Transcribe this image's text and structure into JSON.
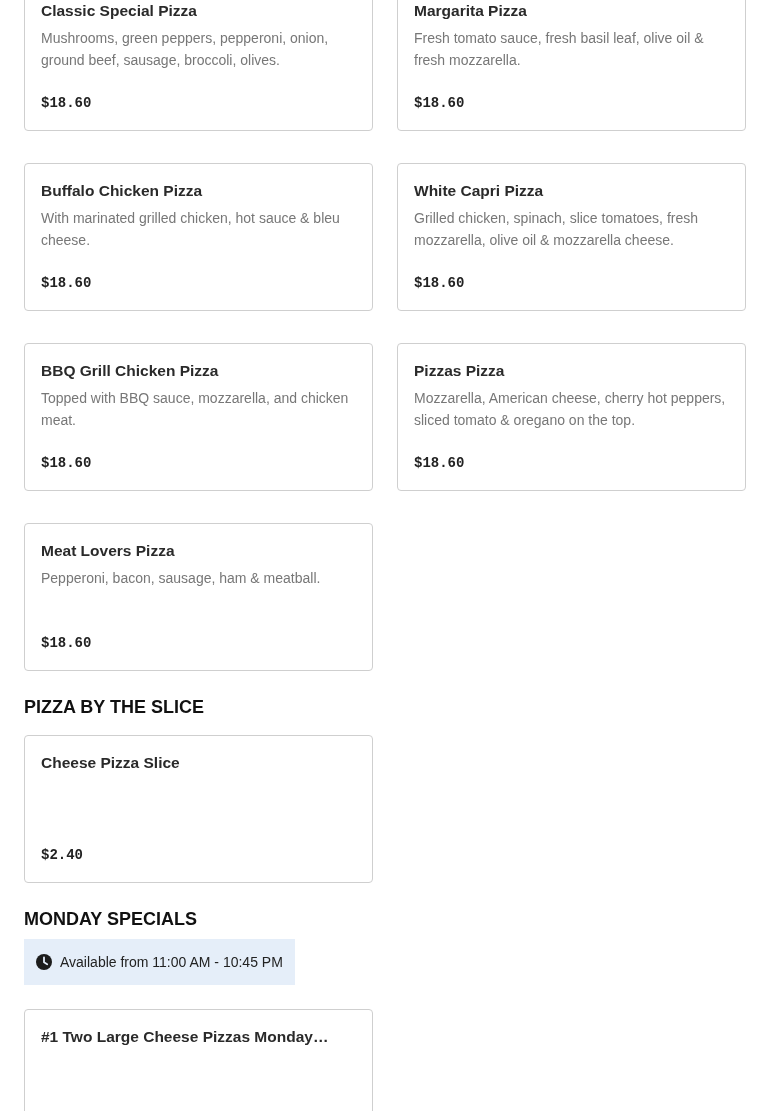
{
  "sections": [
    {
      "items": [
        {
          "name": "Classic Special Pizza",
          "description": "Mushrooms, green peppers, pepperoni, onion, ground beef, sausage, broccoli, olives.",
          "price": "$18.60"
        },
        {
          "name": "Margarita Pizza",
          "description": "Fresh tomato sauce, fresh basil leaf, olive oil & fresh mozzarella.",
          "price": "$18.60"
        },
        {
          "name": "Buffalo Chicken Pizza",
          "description": "With marinated grilled chicken, hot sauce & bleu cheese.",
          "price": "$18.60"
        },
        {
          "name": "White Capri Pizza",
          "description": "Grilled chicken, spinach, slice tomatoes, fresh mozzarella, olive oil & mozzarella cheese.",
          "price": "$18.60"
        },
        {
          "name": "BBQ Grill Chicken Pizza",
          "description": "Topped with BBQ sauce, mozzarella, and chicken meat.",
          "price": "$18.60"
        },
        {
          "name": "Pizzas Pizza",
          "description": "Mozzarella, American cheese, cherry hot peppers, sliced tomato & oregano on the top.",
          "price": "$18.60"
        },
        {
          "name": "Meat Lovers Pizza",
          "description": "Pepperoni, bacon, sausage, ham & meatball.",
          "price": "$18.60"
        }
      ]
    },
    {
      "heading": "PIZZA BY THE SLICE",
      "items": [
        {
          "name": "Cheese Pizza Slice",
          "price": "$2.40"
        }
      ]
    },
    {
      "heading": "MONDAY SPECIALS",
      "availability": "Available from 11:00 AM - 10:45 PM",
      "items": [
        {
          "name": "#1 Two Large Cheese Pizzas Monday…"
        }
      ]
    }
  ]
}
